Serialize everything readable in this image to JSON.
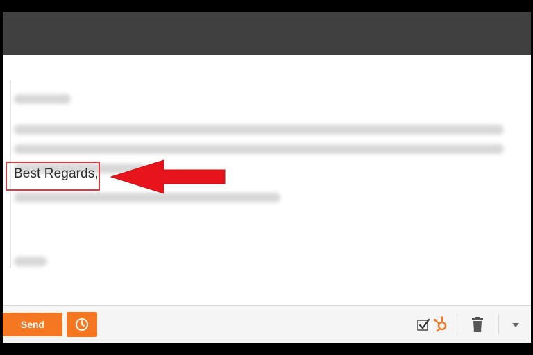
{
  "compose": {
    "signature": "Best Regards,"
  },
  "toolbar": {
    "send_label": "Send"
  },
  "colors": {
    "accent": "#f57722",
    "highlight": "#e03a3a",
    "topbar": "#404040"
  },
  "icons": {
    "schedule": "clock-icon",
    "tasks": "checkbox-icon",
    "hubspot": "hubspot-sprocket-icon",
    "delete": "trash-icon",
    "more": "caret-down-icon"
  }
}
